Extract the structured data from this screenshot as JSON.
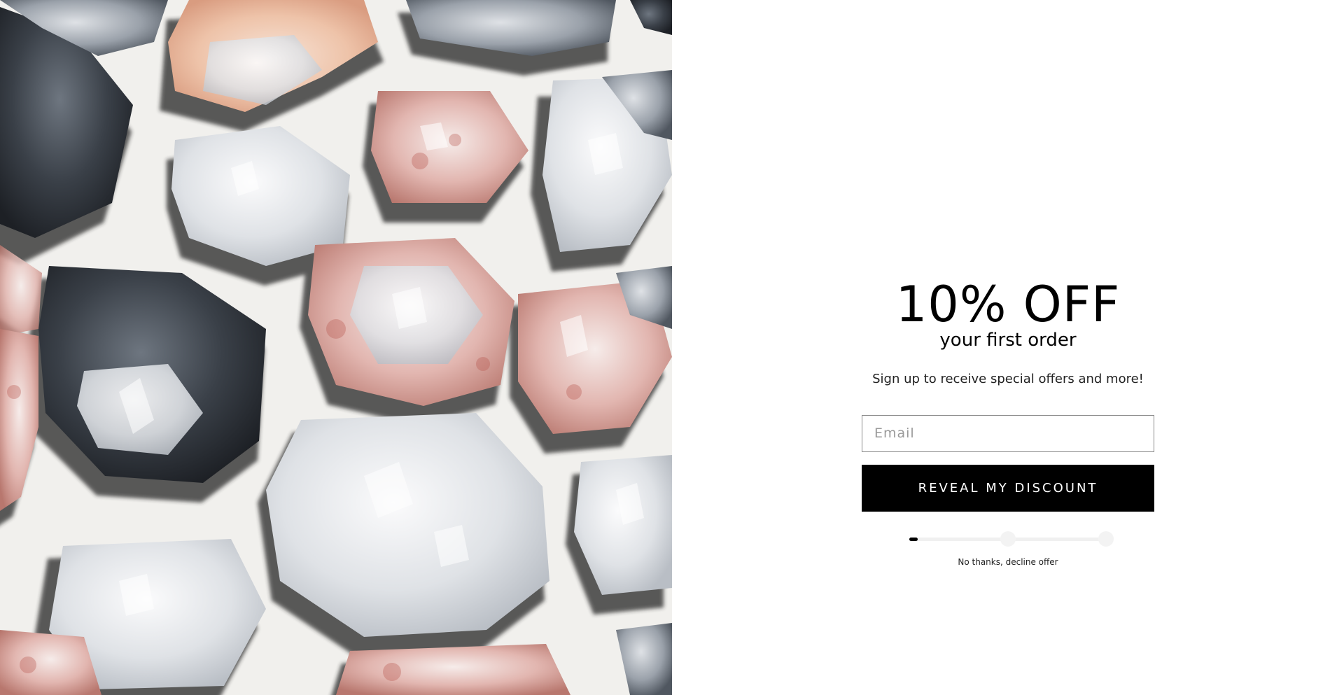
{
  "hero": {
    "image_name": "crystal-clusters-photo"
  },
  "offer": {
    "headline": "10% OFF",
    "subheadline": "your first order",
    "tagline": "Sign up to receive special offers and more!",
    "email_placeholder": "Email",
    "email_value": "",
    "cta_label": "REVEAL MY DISCOUNT",
    "progress": {
      "step": 1,
      "total_steps": 3,
      "fraction": 0.02
    },
    "decline_label": "No thanks, decline offer"
  },
  "colors": {
    "button_bg": "#000000",
    "button_text": "#ffffff",
    "page_bg": "#ffffff",
    "input_border": "#8a8a8a"
  }
}
